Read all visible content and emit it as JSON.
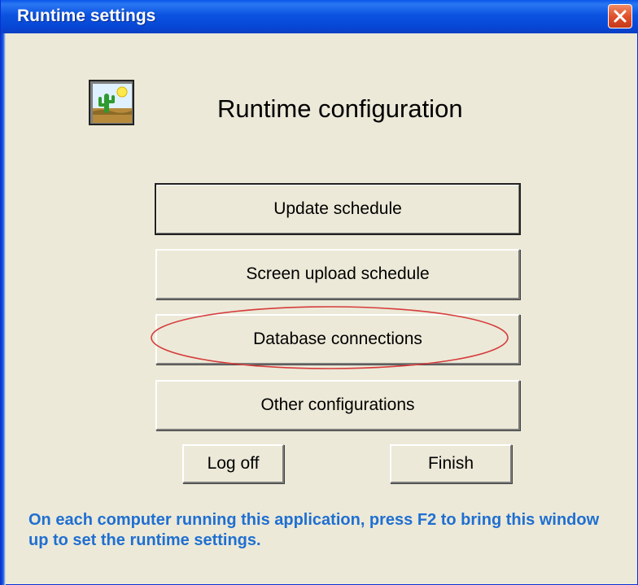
{
  "window": {
    "title": "Runtime settings",
    "close_icon": "close-icon",
    "accent_color": "#0a56e9"
  },
  "header": {
    "app_icon": "desert-cactus-icon",
    "heading": "Runtime configuration"
  },
  "buttons": {
    "update_schedule": "Update schedule",
    "screen_upload_schedule": "Screen upload schedule",
    "database_connections": "Database connections",
    "other_configurations": "Other configurations",
    "log_off": "Log off",
    "finish": "Finish"
  },
  "annotation": {
    "highlight_color": "#d63c3c"
  },
  "note": {
    "text": "On each computer running this application, press F2 to bring this window up to set the runtime settings.",
    "color": "#1f6fd1"
  }
}
